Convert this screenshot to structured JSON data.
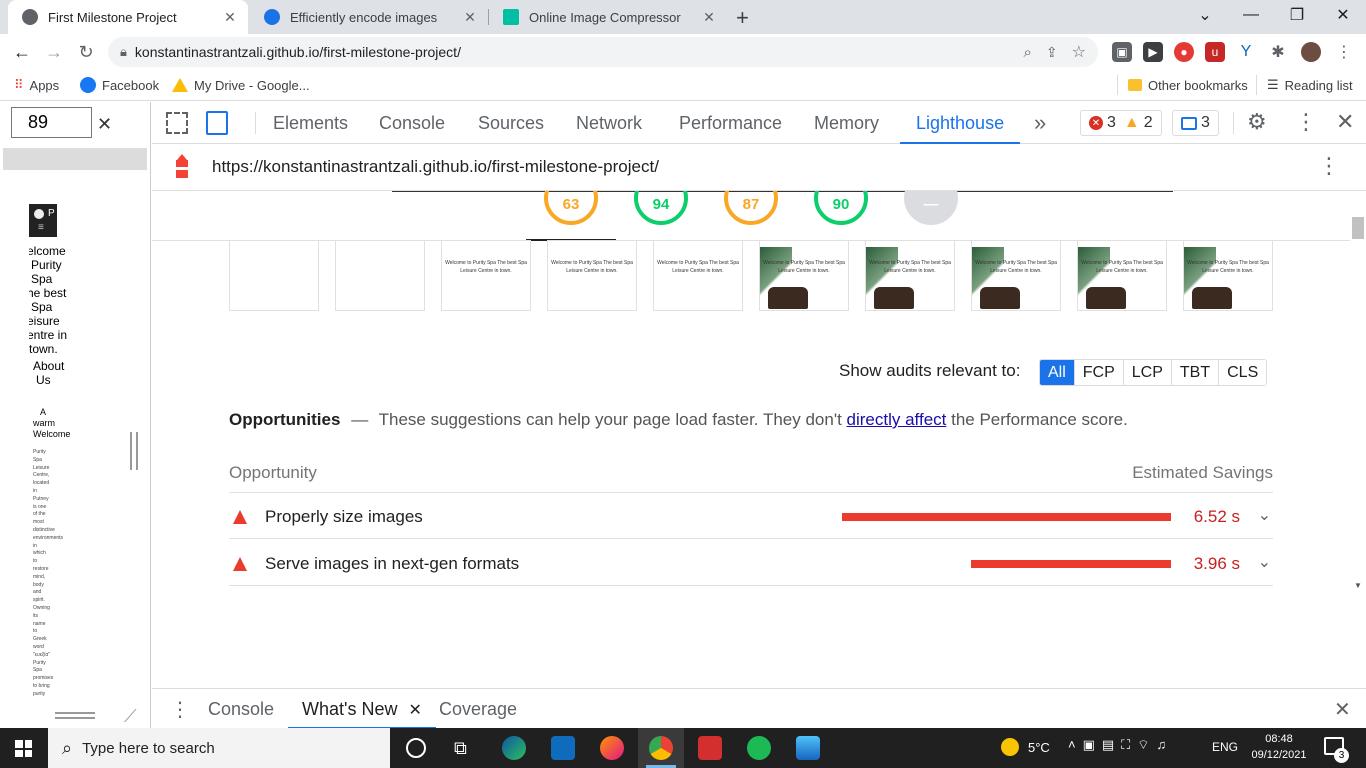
{
  "browser": {
    "tabs": [
      {
        "title": "First Milestone Project",
        "active": true
      },
      {
        "title": "Efficiently encode images",
        "active": false
      },
      {
        "title": "Online Image Compressor",
        "active": false
      }
    ],
    "new_tab": "+",
    "address": "konstantinastrantzali.github.io/first-milestone-project/",
    "bookmarks": [
      {
        "label": "Apps"
      },
      {
        "label": "Facebook"
      },
      {
        "label": "My Drive - Google..."
      }
    ],
    "other_bookmarks": "Other bookmarks",
    "reading_list": "Reading list"
  },
  "page_preview": {
    "zoom_value": "89",
    "nav_letter": "P",
    "hero_text": [
      "elcome",
      "Purity",
      "Spa",
      "he best",
      "Spa",
      "eisure",
      "entre in",
      "town."
    ],
    "about": [
      "About",
      "Us"
    ],
    "warm": [
      "A",
      "warm",
      "Welcome"
    ],
    "tiny_text": [
      "Purity",
      "Spa",
      "Leisure",
      "Centre,",
      "located",
      "in",
      "Putney",
      "is one",
      "of the",
      "most",
      "distinctive",
      "environments",
      "in",
      "which",
      "to",
      "restore",
      "mind,",
      "body",
      "and",
      "spirit.",
      "Owning",
      "its",
      "name",
      "to",
      "Greek",
      "word",
      "\"ευεξία\"",
      "Purity",
      "Spa",
      "promises",
      "to bring",
      "purity"
    ]
  },
  "devtools": {
    "tabs": [
      "Elements",
      "Console",
      "Sources",
      "Network",
      "Performance",
      "Memory",
      "Lighthouse"
    ],
    "active_tab": "Lighthouse",
    "more": "»",
    "errors": "3",
    "warnings": "2",
    "messages": "3",
    "report_url": "https://konstantinastrantzali.github.io/first-milestone-project/"
  },
  "report": {
    "scores": [
      {
        "value": "63",
        "color": "#f9a825"
      },
      {
        "value": "94",
        "color": "#0cce6b"
      },
      {
        "value": "87",
        "color": "#f9a825"
      },
      {
        "value": "90",
        "color": "#0cce6b"
      }
    ],
    "frame_caption": "Welcome to Purity Spa The best Spa Leisure Centre in town.",
    "filter_label": "Show audits relevant to:",
    "filters": [
      "All",
      "FCP",
      "LCP",
      "TBT",
      "CLS"
    ],
    "selected_filter": "All",
    "opportunities": {
      "title": "Opportunities",
      "dash": "—",
      "desc_before": "These suggestions can help your page load faster. They don't",
      "link": "directly affect",
      "desc_after": "the Performance score.",
      "col_left": "Opportunity",
      "col_right": "Estimated Savings",
      "rows": [
        {
          "label": "Properly size images",
          "savings": "6.52 s",
          "seconds": 6.52
        },
        {
          "label": "Serve images in next-gen formats",
          "savings": "3.96 s",
          "seconds": 3.96
        }
      ]
    }
  },
  "drawer": {
    "tabs": [
      "Console",
      "What's New",
      "Coverage"
    ],
    "active": "What's New"
  },
  "taskbar": {
    "search_placeholder": "Type here to search",
    "weather": "5°C",
    "language": "ENG",
    "time": "08:48",
    "date": "09/12/2021",
    "notifications": "3"
  }
}
